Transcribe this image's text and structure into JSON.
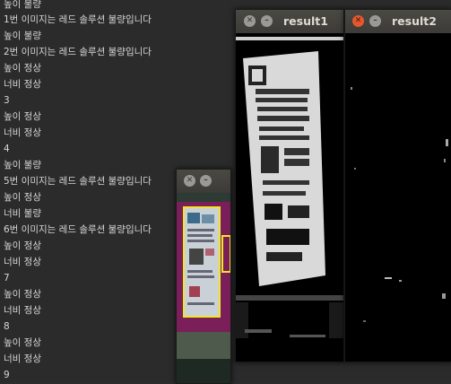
{
  "terminal": {
    "lines": [
      "높이 불량",
      "1번 이미지는 레드 솔루션 불량입니다",
      "높이 불량",
      "2번 이미지는 레드 솔루션 불량입니다",
      "높이 정상",
      "너비 정상",
      "3",
      "높이 정상",
      "너비 정상",
      "4",
      "높이 불량",
      "5번 이미지는 레드 솔루션 불량입니다",
      "높이 정상",
      "너비 불량",
      "6번 이미지는 레드 솔루션 불량입니다",
      "높이 정상",
      "너비 정상",
      "7",
      "높이 정상",
      "너비 정상",
      "8",
      "높이 정상",
      "너비 정상",
      "9"
    ]
  },
  "windows": {
    "preview": {
      "title": ""
    },
    "result1": {
      "title": "result1"
    },
    "result2": {
      "title": "result2"
    }
  },
  "icons": {
    "close": "close-icon",
    "minimize": "minimize-icon"
  },
  "colors": {
    "detection_box": "#f0e628",
    "close_active": "#e5572d",
    "titlebar": "#3c3b37"
  }
}
